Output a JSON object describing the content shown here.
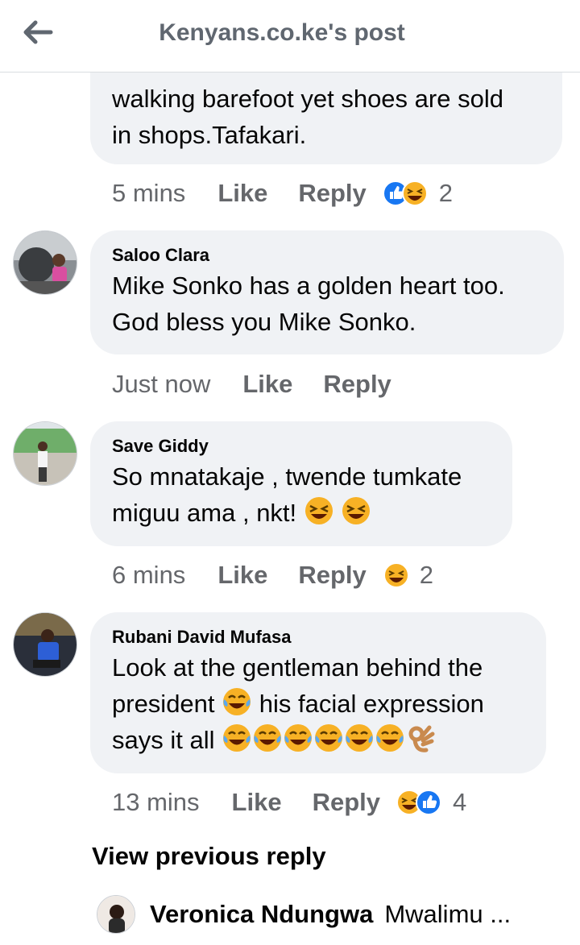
{
  "header": {
    "title": "Kenyans.co.ke's post"
  },
  "comments": [
    {
      "text_lines": [
        "walking barefoot yet shoes are sold",
        "in shops.Tafakari."
      ],
      "time": "5 mins",
      "like": "Like",
      "reply": "Reply",
      "reactions": [
        "like",
        "haha"
      ],
      "reaction_count": "2"
    },
    {
      "author": "Saloo Clara",
      "text_lines": [
        "Mike Sonko  has a golden heart too.",
        "God bless you Mike Sonko."
      ],
      "time": "Just now",
      "like": "Like",
      "reply": "Reply"
    },
    {
      "author": "Save Giddy",
      "text_lines": [
        "So mnatakaje , twende tumkate",
        "miguu ama , nkt!"
      ],
      "time": "6 mins",
      "like": "Like",
      "reply": "Reply",
      "reactions": [
        "haha"
      ],
      "reaction_count": "2"
    },
    {
      "author": "Rubani David Mufasa",
      "text_lines": [
        "Look at the gentleman behind the",
        "president",
        "his facial expression",
        "says it all"
      ],
      "time": "13 mins",
      "like": "Like",
      "reply": "Reply",
      "reactions": [
        "haha",
        "like"
      ],
      "reaction_count": "4"
    }
  ],
  "view_previous": "View previous reply",
  "next_comment": {
    "author": "Veronica Ndungwa",
    "snippet": "Mwalimu ..."
  },
  "colors": {
    "bubble": "#f0f2f5",
    "meta_text": "#65676b",
    "like_blue": "#1877f2",
    "haha_yellow": "#f7b125"
  }
}
